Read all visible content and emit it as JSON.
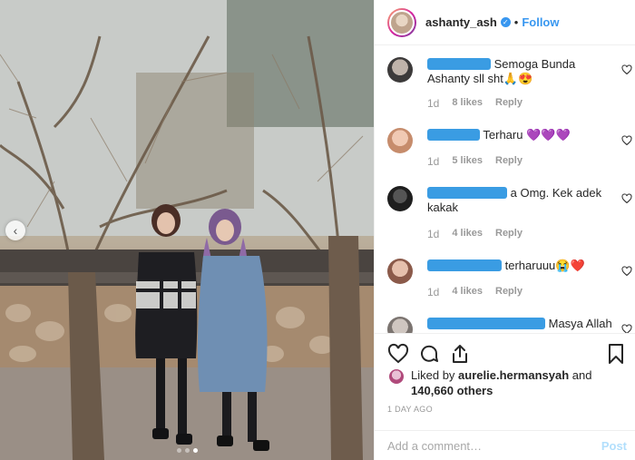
{
  "header": {
    "username": "ashanty_ash",
    "follow_label": "Follow",
    "bullet": "•"
  },
  "comments": [
    {
      "text": "Semoga Bunda Ashanty sll sht🙏😍",
      "time": "1d",
      "likes": "8 likes",
      "reply": "Reply"
    },
    {
      "text": "Terharu 💜💜💜",
      "time": "1d",
      "likes": "5 likes",
      "reply": "Reply"
    },
    {
      "text": "a Omg. Kek adek kakak",
      "time": "1d",
      "likes": "4 likes",
      "reply": "Reply"
    },
    {
      "text": "terharuuu😭❤️",
      "time": "1d",
      "likes": "4 likes",
      "reply": "Reply"
    },
    {
      "text": "Masya Allah",
      "time": "",
      "likes": "",
      "reply": ""
    }
  ],
  "likes": {
    "prefix": "Liked by ",
    "liker": "aurelie.hermansyah",
    "connector": " and",
    "count": "140,660 others"
  },
  "date": "1 DAY AGO",
  "comment_box": {
    "placeholder": "Add a comment…",
    "post_label": "Post"
  },
  "icons": {
    "like": "heart-icon",
    "comment": "comment-bubble-icon",
    "share": "share-icon",
    "save": "bookmark-icon",
    "verified": "verified-badge-icon"
  },
  "colors": {
    "accent": "#3897f0",
    "post_disabled": "#b2dffc",
    "muted": "#999999"
  }
}
